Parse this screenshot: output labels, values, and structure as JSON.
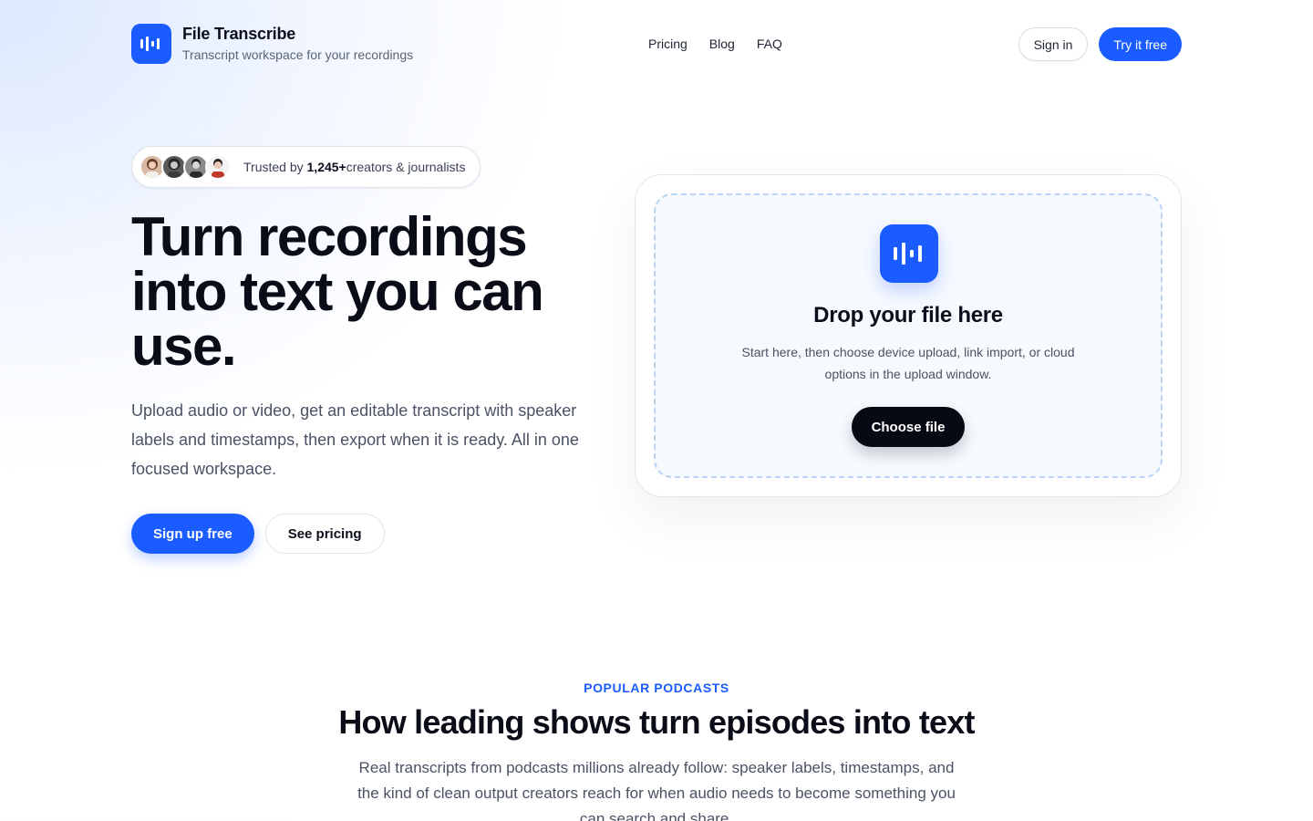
{
  "colors": {
    "accent": "#1a5cff",
    "dark_button": "#070a14",
    "dropzone_border": "#b9d4f4"
  },
  "header": {
    "logo_icon": "waveform-icon",
    "brand_name": "File Transcribe",
    "tagline": "Transcript workspace for your recordings",
    "nav": [
      "Pricing",
      "Blog",
      "FAQ"
    ],
    "signin_label": "Sign in",
    "try_label": "Try it free"
  },
  "hero": {
    "trust_prefix": "Trusted by ",
    "trust_count": "1,245+",
    "trust_suffix": "creators & journalists",
    "title": "Turn recordings into text you can use.",
    "subtitle": "Upload audio or video, get an editable transcript with speaker labels and timestamps, then export when it is ready. All in one focused workspace.",
    "signup_label": "Sign up free",
    "pricing_label": "See pricing"
  },
  "upload": {
    "icon": "waveform-icon",
    "title": "Drop your file here",
    "description": "Start here, then choose device upload, link import, or cloud options in the upload window.",
    "choose_label": "Choose file"
  },
  "section": {
    "eyebrow": "POPULAR PODCASTS",
    "title": "How leading shows turn episodes into text",
    "description": "Real transcripts from podcasts millions already follow: speaker labels, timestamps, and the kind of clean output creators reach for when audio needs to become something you can search and share."
  }
}
